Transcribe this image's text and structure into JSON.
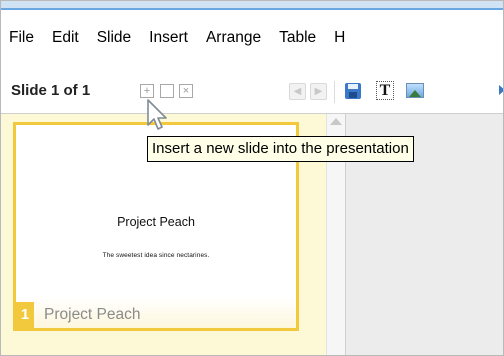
{
  "menu": {
    "items": [
      "File",
      "Edit",
      "Slide",
      "Insert",
      "Arrange",
      "Table",
      "H"
    ]
  },
  "toolbar": {
    "slide_count": "Slide 1 of 1",
    "icons": {
      "new_slide": "plus-square-icon",
      "duplicate_slide": "duplicate-slide-icon",
      "delete_slide": "delete-slide-icon",
      "prev_slide": "arrow-left-icon",
      "next_slide": "arrow-right-icon",
      "save": "save-icon",
      "text_box": "text-box-icon",
      "image": "image-icon"
    },
    "new_slide_glyph": "+",
    "delete_slide_glyph": "×",
    "text_box_glyph": "T",
    "prev_glyph": "◀",
    "next_glyph": "▶"
  },
  "tooltip": {
    "text": "Insert a new slide into the presentation"
  },
  "slide_panel": {
    "slides": [
      {
        "number": "1",
        "title": "Project Peach",
        "subtitle": "The sweetest idea since nectarines.",
        "name": "Project Peach"
      }
    ]
  },
  "colors": {
    "accent_blue": "#6aa7e0",
    "thumb_border": "#f2c83c",
    "sidebar_bg": "#fdf8d6",
    "canvas_bg": "#ececec",
    "tooltip_bg": "#ffffe8"
  }
}
